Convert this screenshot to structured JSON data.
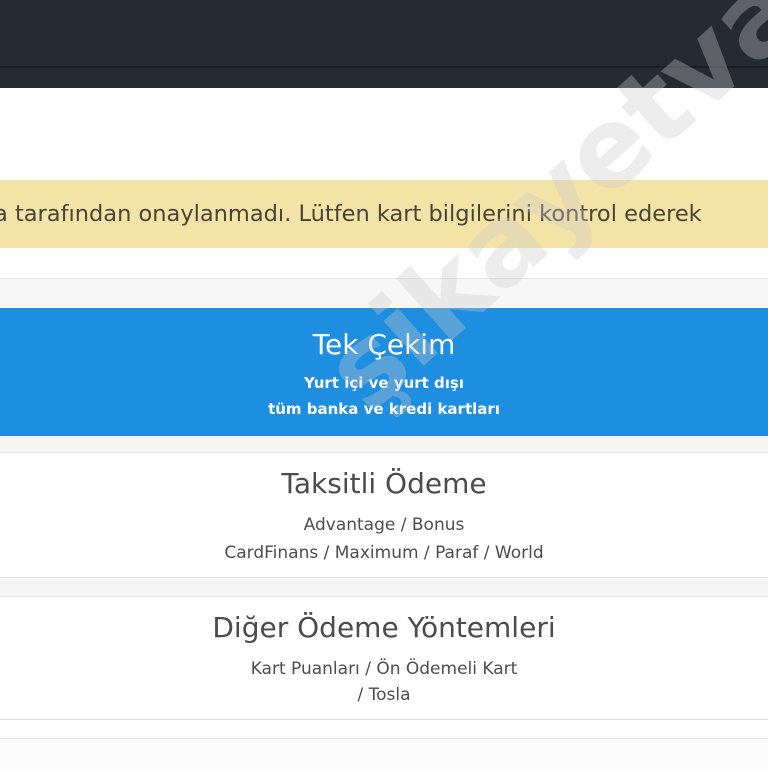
{
  "alert": {
    "message": "a tarafından onaylanmadı. Lütfen kart bilgilerini kontrol ederek"
  },
  "payment_options": [
    {
      "title": "Tek Çekim",
      "lines": [
        "Yurt içi ve yurt dışı",
        "tüm banka ve kredi kartları"
      ]
    },
    {
      "title": "Taksitli Ödeme",
      "lines": [
        "Advantage / Bonus",
        "CardFinans / Maximum / Paraf / World"
      ]
    },
    {
      "title": "Diğer Ödeme Yöntemleri",
      "lines": [
        "Kart Puanları / Ön Ödemeli Kart",
        "/ Tosla"
      ]
    }
  ],
  "watermark": "şikayetvar",
  "colors": {
    "topbar": "#262a33",
    "alert_bg": "#f4e3a6",
    "primary": "#1e8ee0"
  }
}
